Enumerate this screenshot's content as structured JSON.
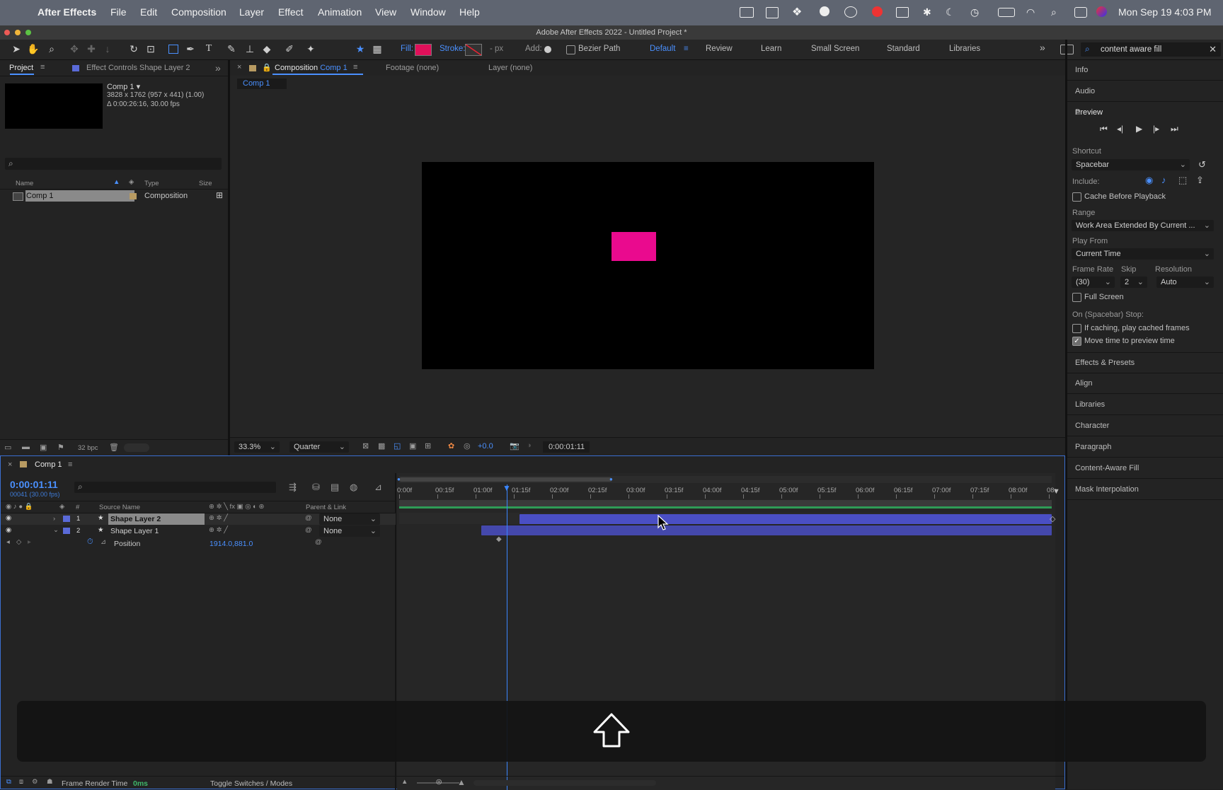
{
  "menubar": {
    "app": "After Effects",
    "items": [
      "File",
      "Edit",
      "Composition",
      "Layer",
      "Effect",
      "Animation",
      "View",
      "Window",
      "Help"
    ],
    "clock": "Mon Sep 19  4:03 PM"
  },
  "window": {
    "title": "Adobe After Effects 2022 - Untitled Project *"
  },
  "toolbar": {
    "fill_label": "Fill:",
    "stroke_label": "Stroke:",
    "px_label": "- px",
    "add_label": "Add:",
    "bezier_label": "Bezier Path",
    "fill_color": "#e0105a",
    "workspaces": [
      "Default",
      "Review",
      "Learn",
      "Small Screen",
      "Standard",
      "Libraries"
    ],
    "search_value": "content aware fill"
  },
  "project": {
    "tab": "Project",
    "tab2": "Effect Controls Shape Layer 2",
    "comp_name": "Comp 1 ▾",
    "comp_size": "3828 x 1762  (957 x 441) (1.00)",
    "comp_duration": "Δ 0:00:26:16, 30.00 fps",
    "col_name": "Name",
    "col_type": "Type",
    "col_size": "Size",
    "item_name": "Comp 1",
    "item_type": "Composition",
    "bpc": "32 bpc"
  },
  "viewer": {
    "tab_prefix": "Composition",
    "tab_comp": "Comp 1",
    "footage_tab": "Footage (none)",
    "layer_tab": "Layer (none)",
    "breadcrumb": "Comp 1",
    "zoom": "33.3%",
    "resolution": "Quarter",
    "exposure": "+0.0",
    "timecode": "0:00:01:11",
    "shape_color": "#ea0a8e"
  },
  "timeline": {
    "tab": "Comp 1",
    "timecode": "0:00:01:11",
    "frames": "00041 (30.00 fps)",
    "col_source": "Source Name",
    "col_parent": "Parent & Link",
    "ruler": [
      "0:00f",
      "00:15f",
      "01:00f",
      "01:15f",
      "02:00f",
      "02:15f",
      "03:00f",
      "03:15f",
      "04:00f",
      "04:15f",
      "05:00f",
      "05:15f",
      "06:00f",
      "06:15f",
      "07:00f",
      "07:15f",
      "08:00f",
      "08:"
    ],
    "layers": [
      {
        "num": "1",
        "name": "Shape Layer 2",
        "parent": "None"
      },
      {
        "num": "2",
        "name": "Shape Layer 1",
        "parent": "None"
      }
    ],
    "position_label": "Position",
    "position_value": "1914.0,881.0",
    "frame_render_label": "Frame Render Time",
    "frame_render_value": "0ms",
    "toggle_label": "Toggle Switches / Modes",
    "layer_color": "#4a4fc4"
  },
  "right": {
    "info": "Info",
    "audio": "Audio",
    "preview": "Preview",
    "shortcut_label": "Shortcut",
    "shortcut_value": "Spacebar",
    "include_label": "Include:",
    "cache_label": "Cache Before Playback",
    "range_label": "Range",
    "range_value": "Work Area Extended By Current ...",
    "playfrom_label": "Play From",
    "playfrom_value": "Current Time",
    "framerate_label": "Frame Rate",
    "skip_label": "Skip",
    "resolution_label": "Resolution",
    "framerate_value": "(30)",
    "skip_value": "2",
    "resolution_value": "Auto",
    "fullscreen_label": "Full Screen",
    "stop_label": "On (Spacebar) Stop:",
    "caching_label": "If caching, play cached frames",
    "movetime_label": "Move time to preview time",
    "panels": [
      "Effects & Presets",
      "Align",
      "Libraries",
      "Character",
      "Paragraph",
      "Content-Aware Fill",
      "Mask Interpolation"
    ]
  }
}
